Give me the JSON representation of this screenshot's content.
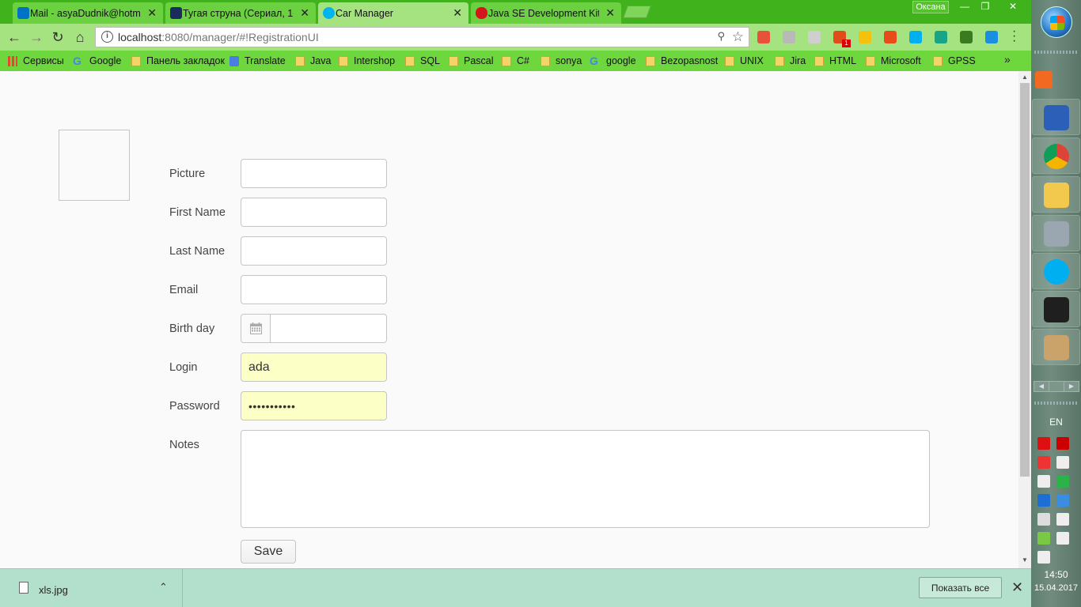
{
  "browser": {
    "tabs": [
      {
        "title": "Mail - asyaDudnik@hotm",
        "active": false,
        "favicon_color": "#0072c6"
      },
      {
        "title": "Тугая струна (Сериал, 1-",
        "active": false,
        "favicon_color": "#1b2b5c"
      },
      {
        "title": "Car Manager",
        "active": true,
        "favicon_color": "#00b4f0"
      },
      {
        "title": "Java SE Development Kit",
        "active": false,
        "favicon_color": "#d4161c"
      }
    ],
    "user": "Оксана",
    "window_controls": {
      "minimize": "—",
      "restore": "❐",
      "close": "✕"
    },
    "address": {
      "host": "localhost",
      "rest": ":8080/manager/#!RegistrationUI"
    },
    "bookmarks": [
      {
        "label": "Сервисы",
        "icon": "apps-icon"
      },
      {
        "label": "Google",
        "icon": "google-icon"
      },
      {
        "label": "Панель закладок",
        "icon": "folder-icon"
      },
      {
        "label": "Translate",
        "icon": "translate-icon"
      },
      {
        "label": "Java",
        "icon": "folder-icon"
      },
      {
        "label": "Intershop",
        "icon": "folder-icon"
      },
      {
        "label": "SQL",
        "icon": "folder-icon"
      },
      {
        "label": "Pascal",
        "icon": "folder-icon"
      },
      {
        "label": "C#",
        "icon": "folder-icon"
      },
      {
        "label": "sonya",
        "icon": "folder-icon"
      },
      {
        "label": "google",
        "icon": "google-icon"
      },
      {
        "label": "Bezopasnost",
        "icon": "folder-icon"
      },
      {
        "label": "UNIX",
        "icon": "folder-icon"
      },
      {
        "label": "Jira",
        "icon": "folder-icon"
      },
      {
        "label": "HTML",
        "icon": "folder-icon"
      },
      {
        "label": "Microsoft",
        "icon": "folder-icon"
      },
      {
        "label": "GPSS",
        "icon": "folder-icon"
      }
    ],
    "bookmarks_more": "»",
    "extension_badge": "1",
    "extensions": [
      {
        "name": "extension-red-icon",
        "color": "#e8513a"
      },
      {
        "name": "extension-s-icon",
        "color": "#b9b9b9"
      },
      {
        "name": "extension-gray-icon",
        "color": "#cfcfcf"
      },
      {
        "name": "extension-shield-icon",
        "color": "#e04c1a"
      },
      {
        "name": "extension-pinwheel-icon",
        "color": "#f4c20d"
      },
      {
        "name": "office-icon",
        "color": "#e84c1a"
      },
      {
        "name": "skype-extension-icon",
        "color": "#00aff0"
      },
      {
        "name": "eye-extension-icon",
        "color": "#17a589"
      },
      {
        "name": "pdf-extension-icon",
        "color": "#3b7b1f"
      },
      {
        "name": "cloud-extension-icon",
        "color": "#1a8fe0"
      }
    ]
  },
  "form": {
    "fields": [
      {
        "label": "Picture",
        "value": "",
        "type": "text",
        "filled": false
      },
      {
        "label": "First Name",
        "value": "",
        "type": "text",
        "filled": false
      },
      {
        "label": "Last Name",
        "value": "",
        "type": "text",
        "filled": false
      },
      {
        "label": "Email",
        "value": "",
        "type": "text",
        "filled": false
      }
    ],
    "birthday": {
      "label": "Birth day",
      "value": ""
    },
    "login": {
      "label": "Login",
      "value": "ada",
      "filled": true
    },
    "password": {
      "label": "Password",
      "value": "•••••••••••",
      "filled": true
    },
    "notes": {
      "label": "Notes",
      "value": ""
    },
    "save_label": "Save"
  },
  "downloads": {
    "file_name": "xls.jpg",
    "show_all_label": "Показать все",
    "close_glyph": "✕",
    "chevron_glyph": "⌃"
  },
  "taskbar": {
    "apps": [
      {
        "name": "media-player-app",
        "color": "#f07b2a"
      },
      {
        "name": "library-app",
        "color": "#2b5fb8"
      },
      {
        "name": "chrome-app",
        "color": "#db4437"
      },
      {
        "name": "explorer-app",
        "color": "#f2c94c"
      },
      {
        "name": "scanner-app",
        "color": "#9aa7b0"
      },
      {
        "name": "skype-app",
        "color": "#00aff0"
      },
      {
        "name": "intellij-app",
        "color": "#1f1f1f"
      },
      {
        "name": "paint-app",
        "color": "#c9a36a"
      }
    ],
    "language": "EN",
    "time": "14:50",
    "date": "15.04.2017",
    "tray_icons": [
      {
        "name": "antivirus-tray-icon",
        "color": "#d11"
      },
      {
        "name": "pdf-tray-icon",
        "color": "#c00"
      },
      {
        "name": "flag-red-tray-icon",
        "color": "#e33"
      },
      {
        "name": "usb-tray-icon",
        "color": "#eee"
      },
      {
        "name": "volume-tray-icon",
        "color": "#eee"
      },
      {
        "name": "shield-check-tray-icon",
        "color": "#2bb34a"
      },
      {
        "name": "bluetooth-tray-icon",
        "color": "#1d6fd8"
      },
      {
        "name": "network-adapter-tray-icon",
        "color": "#3a8de0"
      },
      {
        "name": "monitor-tray-icon",
        "color": "#ddd"
      },
      {
        "name": "signal-tray-icon",
        "color": "#eee"
      },
      {
        "name": "leaf-tray-icon",
        "color": "#7ac943"
      },
      {
        "name": "action-center-tray-icon",
        "color": "#eee"
      },
      {
        "name": "battery-tray-icon",
        "color": "#eee"
      }
    ]
  }
}
